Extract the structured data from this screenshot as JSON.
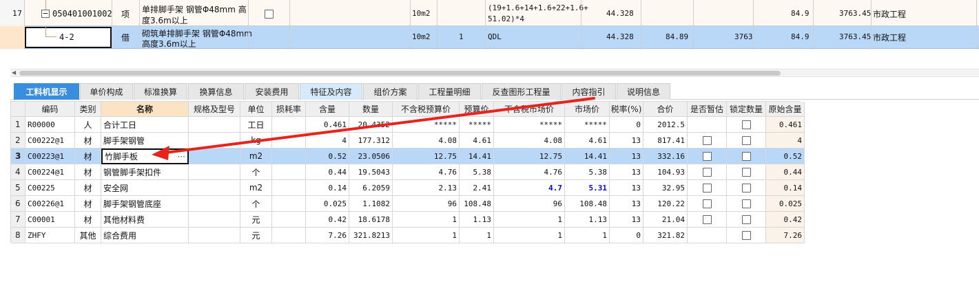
{
  "top_grid": {
    "rows": [
      {
        "num": "17",
        "code": "050401001002",
        "type": "项",
        "name_line1": "单排脚手架 钢管Φ48mm 高",
        "name_line2": "度3.6m以上",
        "unit": "10m2",
        "qty": "",
        "formula_line1": "(19+1.6+14+1.6+22+1.6+",
        "formula_line2": "51.02)*4",
        "v1": "44.328",
        "v2": "",
        "v3": "",
        "v4": "84.9",
        "v5": "3763.45",
        "spec": "市政工程"
      },
      {
        "num": "",
        "code": "4-2",
        "type": "借",
        "name_line1": "砌筑单排脚手架 钢管Φ48mm",
        "name_line2": "高度3.6m以上",
        "unit": "10m2",
        "qty": "1",
        "formula_line1": "QDL",
        "formula_line2": "",
        "v1": "44.328",
        "v2": "84.89",
        "v3": "3763",
        "v4": "84.9",
        "v5": "3763.45",
        "spec": "市政工程"
      }
    ]
  },
  "tabs": [
    "工料机显示",
    "单价构成",
    "标准换算",
    "换算信息",
    "安装费用",
    "特征及内容",
    "组价方案",
    "工程量明细",
    "反查图形工程量",
    "内容指引",
    "说明信息"
  ],
  "bottom_grid": {
    "headers": [
      "编码",
      "类别",
      "名称",
      "规格及型号",
      "单位",
      "损耗率",
      "含量",
      "数量",
      "不含税预算价",
      "预算价",
      "不含税市场价",
      "市场价",
      "税率(%)",
      "合价",
      "是否暂估",
      "锁定数量",
      "原始含量"
    ],
    "rows": [
      {
        "n": "1",
        "code": "R00000",
        "cat": "人",
        "name": "合计工日",
        "spec": "",
        "unit": "工日",
        "loss": "",
        "content": "0.461",
        "qty": "20.4352",
        "p1": "*****",
        "p2": "*****",
        "p3": "*****",
        "p4": "*****",
        "tax": "0",
        "total": "2012.5",
        "est": false,
        "lock": true,
        "orig": "0.461"
      },
      {
        "n": "2",
        "code": "C00222@1",
        "cat": "材",
        "name": "脚手架钢管",
        "spec": "",
        "unit": "kg",
        "loss": "",
        "content": "4",
        "qty": "177.312",
        "p1": "4.08",
        "p2": "4.61",
        "p3": "4.08",
        "p4": "4.61",
        "tax": "13",
        "total": "817.41",
        "est": true,
        "lock": true,
        "orig": "4"
      },
      {
        "n": "3",
        "code": "C00223@1",
        "cat": "材",
        "name": "竹脚手板",
        "spec": "",
        "unit": "m2",
        "loss": "",
        "content": "0.52",
        "qty": "23.0506",
        "p1": "12.75",
        "p2": "14.41",
        "p3": "12.75",
        "p4": "14.41",
        "tax": "13",
        "total": "332.16",
        "est": true,
        "lock": true,
        "orig": "0.52"
      },
      {
        "n": "4",
        "code": "C00224@1",
        "cat": "材",
        "name": "钢管脚手架扣件",
        "spec": "",
        "unit": "个",
        "loss": "",
        "content": "0.44",
        "qty": "19.5043",
        "p1": "4.76",
        "p2": "5.38",
        "p3": "4.76",
        "p4": "5.38",
        "tax": "13",
        "total": "104.93",
        "est": true,
        "lock": true,
        "orig": "0.44"
      },
      {
        "n": "5",
        "code": "C00225",
        "cat": "材",
        "name": "安全网",
        "spec": "",
        "unit": "m2",
        "loss": "",
        "content": "0.14",
        "qty": "6.2059",
        "p1": "2.13",
        "p2": "2.41",
        "p3": "4.7",
        "p4": "5.31",
        "tax": "13",
        "total": "32.95",
        "est": true,
        "lock": true,
        "orig": "0.14"
      },
      {
        "n": "6",
        "code": "C00226@1",
        "cat": "材",
        "name": "脚手架钢管底座",
        "spec": "",
        "unit": "个",
        "loss": "",
        "content": "0.025",
        "qty": "1.1082",
        "p1": "96",
        "p2": "108.48",
        "p3": "96",
        "p4": "108.48",
        "tax": "13",
        "total": "120.22",
        "est": true,
        "lock": true,
        "orig": "0.025"
      },
      {
        "n": "7",
        "code": "C00001",
        "cat": "材",
        "name": "其他材料费",
        "spec": "",
        "unit": "元",
        "loss": "",
        "content": "0.42",
        "qty": "18.6178",
        "p1": "1",
        "p2": "1.13",
        "p3": "1",
        "p4": "1.13",
        "tax": "13",
        "total": "21.04",
        "est": true,
        "lock": true,
        "orig": "0.42"
      },
      {
        "n": "8",
        "code": "ZHFY",
        "cat": "其他",
        "name": "综合费用",
        "spec": "",
        "unit": "元",
        "loss": "",
        "content": "7.26",
        "qty": "321.8213",
        "p1": "1",
        "p2": "1",
        "p3": "1",
        "p4": "1",
        "tax": "0",
        "total": "321.82",
        "est": false,
        "lock": true,
        "orig": "7.26"
      }
    ],
    "ellipsis": "···"
  },
  "colors": {
    "selected_row": "#b9d7f7",
    "highlight_blue": "#0000ff",
    "tab_active": "#3a8ee0",
    "annotation_arrow": "#e8231c"
  },
  "icons": [
    "collapse-minus-icon",
    "ellipsis-icon",
    "scroll-left-icon",
    "annotation-arrow"
  ]
}
